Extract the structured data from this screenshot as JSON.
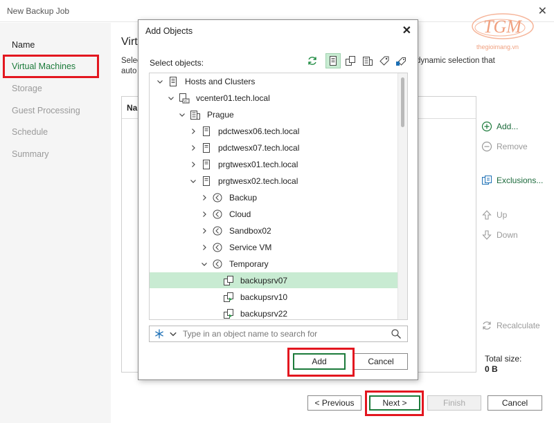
{
  "window": {
    "title": "New Backup Job"
  },
  "logo": {
    "text": "TGM",
    "site": "thegioimang.vn"
  },
  "sidebar": {
    "items": [
      {
        "label": "Name"
      },
      {
        "label": "Virtual Machines"
      },
      {
        "label": "Storage"
      },
      {
        "label": "Guest Processing"
      },
      {
        "label": "Schedule"
      },
      {
        "label": "Summary"
      }
    ]
  },
  "page": {
    "heading": "Virt",
    "desc_line1": "Selec",
    "desc_line2": "auto",
    "desc_right": "dynamic selection that",
    "table_header": "Na"
  },
  "actions": {
    "add": "Add...",
    "remove": "Remove",
    "exclusions": "Exclusions...",
    "up": "Up",
    "down": "Down",
    "recalculate": "Recalculate"
  },
  "total": {
    "label": "Total size:",
    "value": "0 B"
  },
  "footer": {
    "previous": "< Previous",
    "next": "Next >",
    "finish": "Finish",
    "cancel": "Cancel"
  },
  "dialog": {
    "title": "Add Objects",
    "select_label": "Select objects:",
    "tree": [
      {
        "label": "Hosts and Clusters",
        "icon": "infrastructure-icon",
        "expanded": true
      },
      {
        "label": "vcenter01.tech.local",
        "icon": "vcenter-icon",
        "expanded": true
      },
      {
        "label": "Prague",
        "icon": "datacenter-icon",
        "expanded": true
      },
      {
        "label": "pdctwesx06.tech.local",
        "icon": "host-icon",
        "expanded": false
      },
      {
        "label": "pdctwesx07.tech.local",
        "icon": "host-icon",
        "expanded": false
      },
      {
        "label": "prgtwesx01.tech.local",
        "icon": "host-icon",
        "expanded": false
      },
      {
        "label": "prgtwesx02.tech.local",
        "icon": "host-icon",
        "expanded": true
      },
      {
        "label": "Backup",
        "icon": "resource-pool-icon",
        "expanded": false
      },
      {
        "label": "Cloud",
        "icon": "resource-pool-icon",
        "expanded": false
      },
      {
        "label": "Sandbox02",
        "icon": "resource-pool-icon",
        "expanded": false
      },
      {
        "label": "Service VM",
        "icon": "resource-pool-icon",
        "expanded": false
      },
      {
        "label": "Temporary",
        "icon": "resource-pool-icon",
        "expanded": true
      },
      {
        "label": "backupsrv07",
        "icon": "vm-icon",
        "selected": true
      },
      {
        "label": "backupsrv10",
        "icon": "vm-running-icon"
      },
      {
        "label": "backupsrv22",
        "icon": "vm-running-icon"
      }
    ],
    "search_placeholder": "Type in an object name to search for",
    "add": "Add",
    "cancel": "Cancel"
  },
  "colors": {
    "accent_green": "#1b7a3a",
    "highlight": "#e3161f",
    "selection": "#c8ebd2"
  }
}
